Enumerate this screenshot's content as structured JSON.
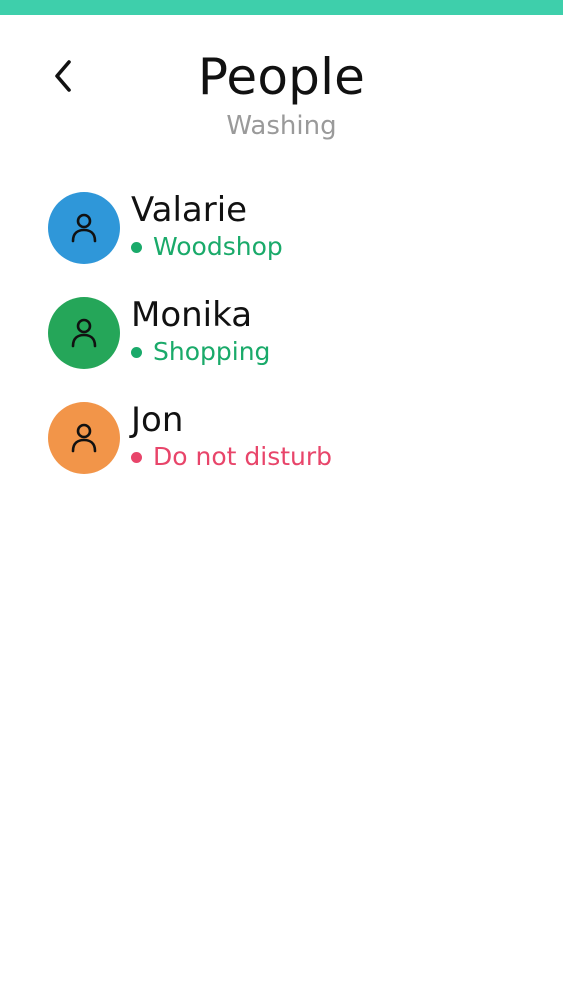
{
  "colors": {
    "accent_bar": "#3ecfab",
    "status_available": "#1aaa6a",
    "status_dnd": "#e8456a",
    "subtitle": "#9a9a9a"
  },
  "header": {
    "back_icon": "chevron-left-icon",
    "title": "People",
    "subtitle": "Washing"
  },
  "people": [
    {
      "name": "Valarie",
      "status": "Woodshop",
      "status_color": "#1aaa6a",
      "avatar_color": "#2f97d9",
      "avatar_icon": "person-icon"
    },
    {
      "name": "Monika",
      "status": "Shopping",
      "status_color": "#1aaa6a",
      "avatar_color": "#25a659",
      "avatar_icon": "person-icon"
    },
    {
      "name": "Jon",
      "status": "Do not disturb",
      "status_color": "#e8456a",
      "avatar_color": "#f29549",
      "avatar_icon": "person-icon"
    }
  ]
}
